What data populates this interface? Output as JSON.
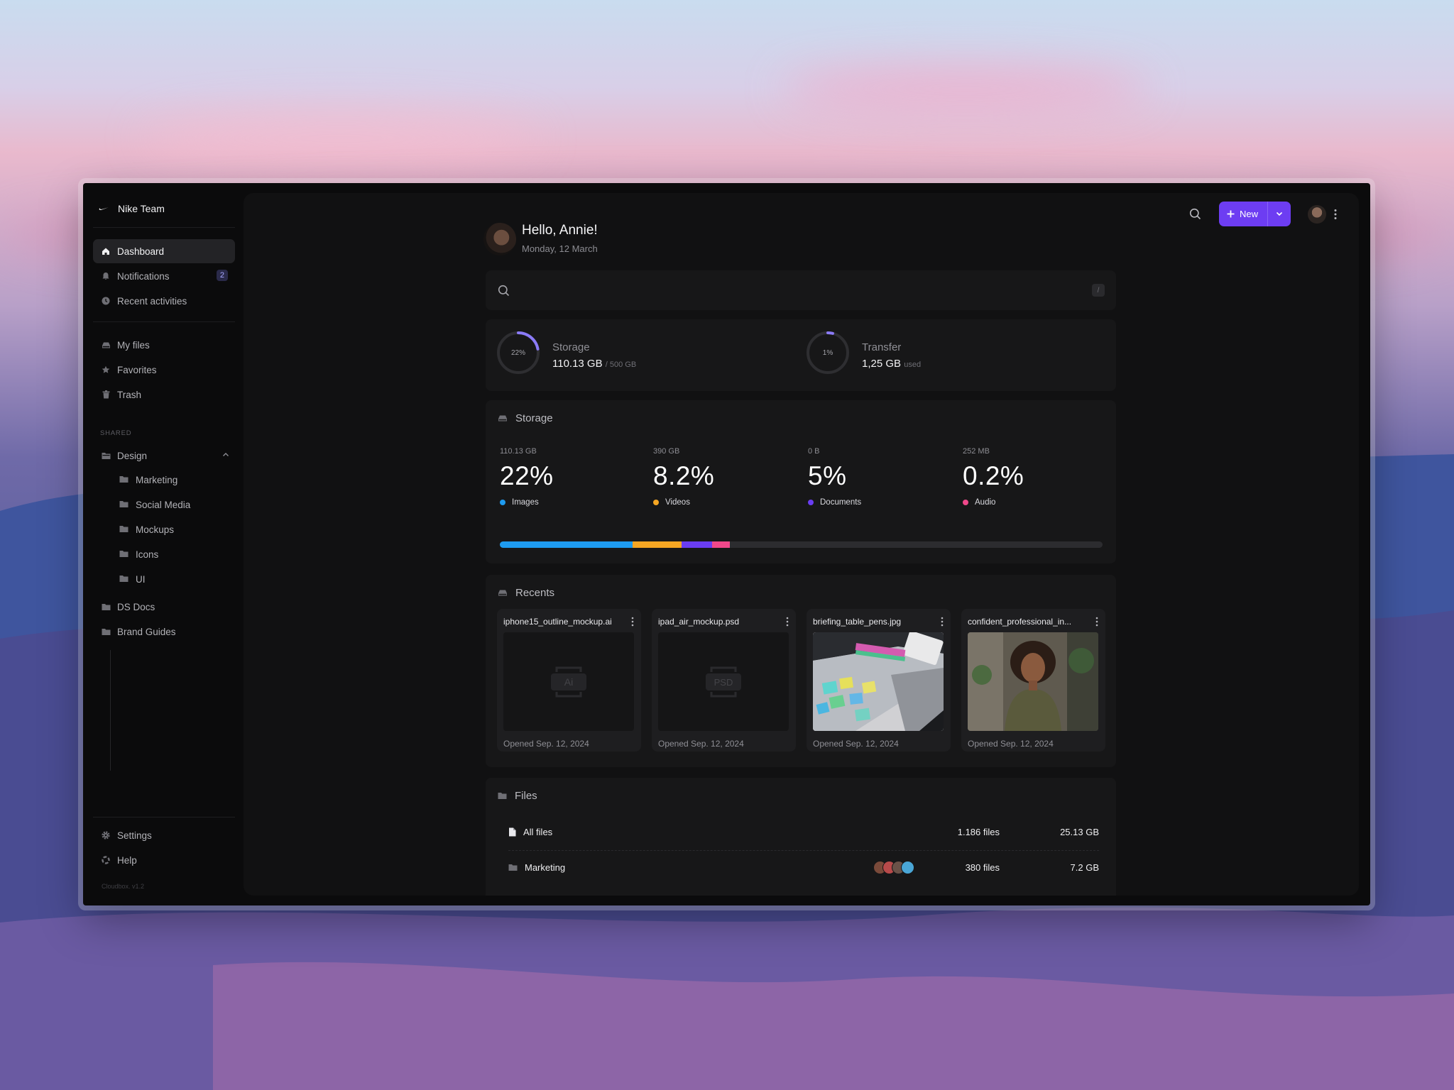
{
  "sidebar": {
    "team": "Nike Team",
    "nav": [
      {
        "label": "Dashboard",
        "icon": "home-icon"
      },
      {
        "label": "Notifications",
        "icon": "bell-icon",
        "badge": "2"
      },
      {
        "label": "Recent activities",
        "icon": "clock-icon"
      }
    ],
    "library": [
      {
        "label": "My files",
        "icon": "drive-icon"
      },
      {
        "label": "Favorites",
        "icon": "star-icon"
      },
      {
        "label": "Trash",
        "icon": "trash-icon"
      }
    ],
    "shared_label": "SHARED",
    "design_folder": "Design",
    "design_children": [
      "Marketing",
      "Social Media",
      "Mockups",
      "Icons",
      "UI"
    ],
    "folders": [
      "DS Docs",
      "Brand Guides"
    ],
    "settings": "Settings",
    "help": "Help",
    "version": "Cloudbox. v1.2"
  },
  "header": {
    "greeting": "Hello, Annie!",
    "date": "Monday, 12 March",
    "new_label": "New"
  },
  "search": {
    "shortcut": "/"
  },
  "usage": {
    "storage": {
      "title": "Storage",
      "percent_label": "22%",
      "percent": 22,
      "value": "110.13 GB",
      "limit": "/ 500 GB"
    },
    "transfer": {
      "title": "Transfer",
      "percent_label": "1%",
      "percent": 1,
      "value": "1,25 GB",
      "suffix": "used"
    }
  },
  "storage_breakdown": {
    "title": "Storage",
    "items": [
      {
        "size": "110.13 GB",
        "percent": "22%",
        "label": "Images",
        "color": "#1e9bf0",
        "share": 22
      },
      {
        "size": "390 GB",
        "percent": "8.2%",
        "label": "Videos",
        "color": "#f5a623",
        "share": 8.2
      },
      {
        "size": "0 B",
        "percent": "5%",
        "label": "Documents",
        "color": "#6a3df2",
        "share": 5
      },
      {
        "size": "252 MB",
        "percent": "0.2%",
        "label": "Audio",
        "color": "#f0488a",
        "share": 3
      }
    ]
  },
  "recents": {
    "title": "Recents",
    "files": [
      {
        "name": "iphone15_outline_mockup.ai",
        "type": "Ai",
        "opened": "Opened Sep. 12, 2024"
      },
      {
        "name": "ipad_air_mockup.psd",
        "type": "PSD",
        "opened": "Opened Sep. 12, 2024"
      },
      {
        "name": "briefing_table_pens.jpg",
        "type": "image",
        "opened": "Opened Sep. 12, 2024"
      },
      {
        "name": "confident_professional_in...",
        "type": "image",
        "opened": "Opened Sep. 12, 2024"
      }
    ]
  },
  "files": {
    "title": "Files",
    "rows": [
      {
        "name": "All files",
        "count": "1.186 files",
        "size": "25.13 GB"
      },
      {
        "name": "Marketing",
        "count": "380 files",
        "size": "7.2 GB"
      }
    ]
  }
}
